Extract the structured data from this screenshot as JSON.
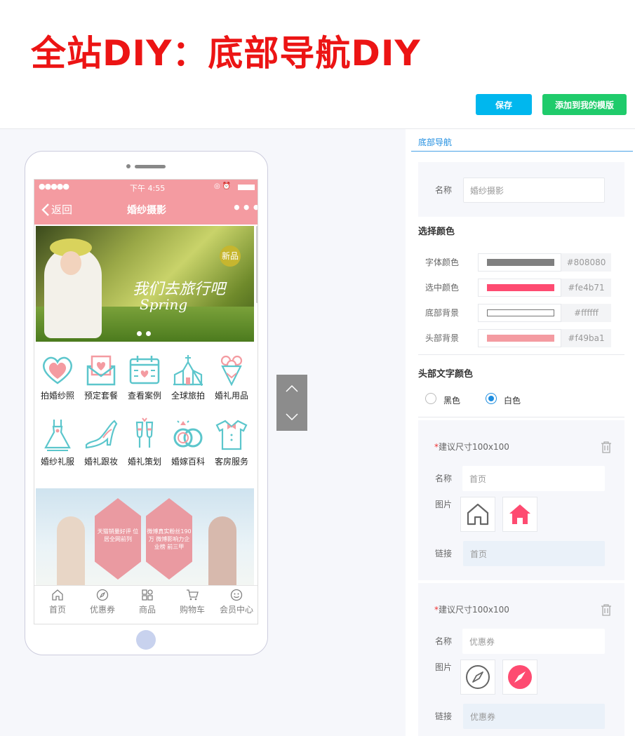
{
  "headline": "全站DIY：底部导航DIY",
  "toolbar": {
    "save_label": "保存",
    "template_label": "添加到我的模版"
  },
  "phone": {
    "status": {
      "signal": "●●●●●",
      "time": "下午 4:55"
    },
    "nav": {
      "back_label": "返回",
      "title": "婚纱摄影"
    },
    "banner": {
      "line1": "我们去旅行吧",
      "line2": "Spring",
      "badge": "新品"
    },
    "grid": [
      {
        "label": "拍婚纱照",
        "icon": "heart-icon"
      },
      {
        "label": "预定套餐",
        "icon": "envelope-icon"
      },
      {
        "label": "查看案例",
        "icon": "calendar-icon"
      },
      {
        "label": "全球旅拍",
        "icon": "church-icon"
      },
      {
        "label": "婚礼用品",
        "icon": "bouquet-icon"
      },
      {
        "label": "婚纱礼服",
        "icon": "dress-icon"
      },
      {
        "label": "婚礼跟妆",
        "icon": "high-heel-icon"
      },
      {
        "label": "婚礼策划",
        "icon": "champagne-icon"
      },
      {
        "label": "婚嫁百科",
        "icon": "rings-icon"
      },
      {
        "label": "客房服务",
        "icon": "tuxedo-icon"
      }
    ],
    "promo": {
      "hex1": "天猫销量好评 位居全网前列",
      "hex2": "微博真实粉丝190万 微博影响力企业榜 前三甲"
    },
    "tabs": [
      {
        "label": "首页",
        "icon": "home-icon"
      },
      {
        "label": "优惠券",
        "icon": "compass-icon"
      },
      {
        "label": "商品",
        "icon": "grid-icon"
      },
      {
        "label": "购物车",
        "icon": "cart-icon"
      },
      {
        "label": "会员中心",
        "icon": "smiley-icon"
      }
    ]
  },
  "panel": {
    "tab_title": "底部导航",
    "name_label": "名称",
    "name_value": "婚纱摄影",
    "color_section": "选择颜色",
    "colors": [
      {
        "label": "字体颜色",
        "value": "#808080"
      },
      {
        "label": "选中颜色",
        "value": "#fe4b71"
      },
      {
        "label": "底部背景",
        "value": "#ffffff"
      },
      {
        "label": "头部背景",
        "value": "#f49ba1"
      }
    ],
    "header_text_section": "头部文字颜色",
    "header_text_options": [
      {
        "label": "黑色",
        "checked": false
      },
      {
        "label": "白色",
        "checked": true
      }
    ],
    "items": [
      {
        "hint": "建议尺寸100x100",
        "name_label": "名称",
        "name": "首页",
        "image_label": "图片",
        "link_label": "链接",
        "link": "首页",
        "icon": "home-icon"
      },
      {
        "hint": "建议尺寸100x100",
        "name_label": "名称",
        "name": "优惠券",
        "image_label": "图片",
        "link_label": "链接",
        "link": "优惠券",
        "icon": "compass-icon"
      }
    ]
  }
}
